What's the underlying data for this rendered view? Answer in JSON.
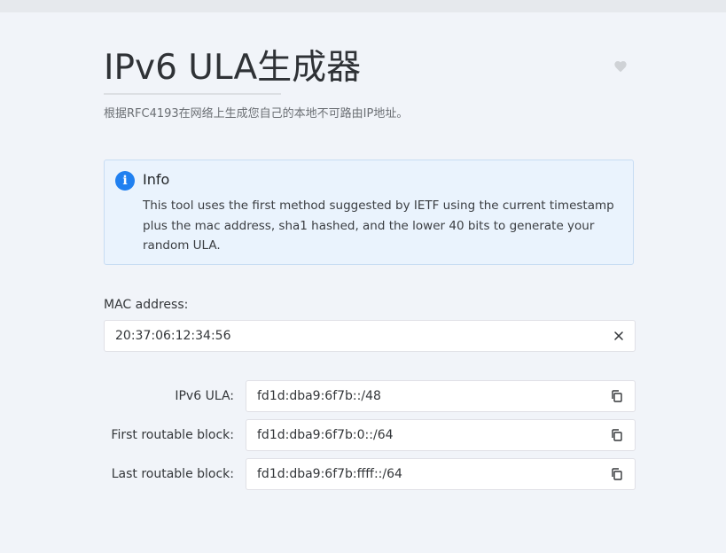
{
  "page": {
    "title": "IPv6 ULA生成器",
    "description": "根据RFC4193在网络上生成您自己的本地不可路由IP地址。",
    "favorite_icon": "heart-icon"
  },
  "info_alert": {
    "icon": "info-icon",
    "icon_glyph": "i",
    "title": "Info",
    "body": "This tool uses the first method suggested by IETF using the current timestamp plus the mac address, sha1 hashed, and the lower 40 bits to generate your random ULA."
  },
  "mac_field": {
    "label": "MAC address:",
    "value": "20:37:06:12:34:56",
    "clear_icon": "close-icon"
  },
  "results": [
    {
      "label": "IPv6 ULA:",
      "value": "fd1d:dba9:6f7b::/48",
      "copy_icon": "copy-icon"
    },
    {
      "label": "First routable block:",
      "value": "fd1d:dba9:6f7b:0::/64",
      "copy_icon": "copy-icon"
    },
    {
      "label": "Last routable block:",
      "value": "fd1d:dba9:6f7b:ffff::/64",
      "copy_icon": "copy-icon"
    }
  ],
  "colors": {
    "background": "#f1f4f9",
    "accent": "#2080f0",
    "alert_background": "#eaf3fd",
    "alert_border": "#c7dcf3"
  }
}
